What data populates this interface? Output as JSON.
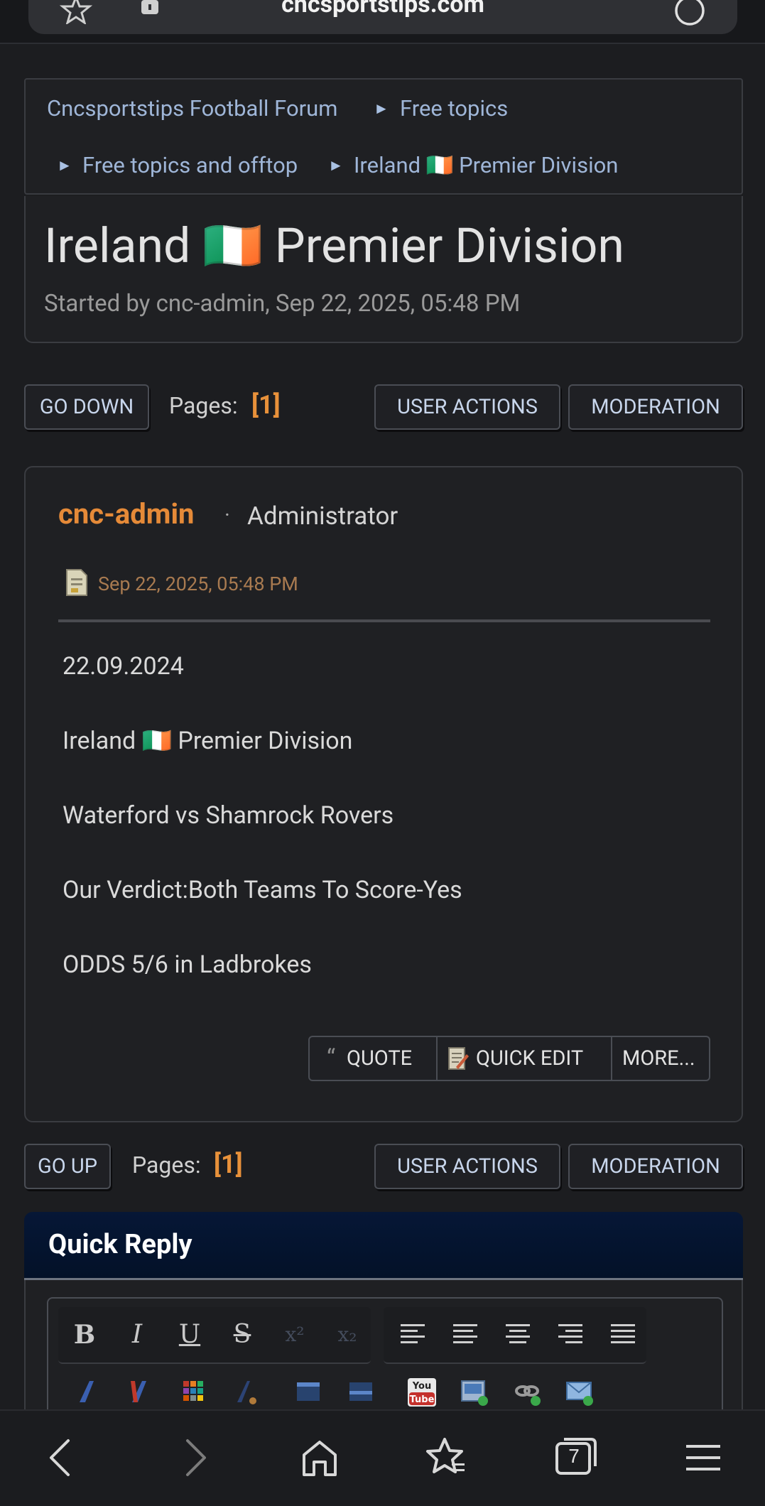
{
  "browser": {
    "url": "cncsportstips.com",
    "tab_count": "7"
  },
  "breadcrumb": {
    "items": [
      "Cncsportstips Football Forum",
      "Free topics",
      "Free topics and offtop",
      "Ireland 🇮🇪 Premier Division"
    ],
    "separator": "►"
  },
  "topic": {
    "title": "Ireland 🇮🇪 Premier Division",
    "started": "Started by cnc-admin, Sep 22, 2025, 05:48 PM"
  },
  "nav_top": {
    "go_down": "GO DOWN",
    "pages_label": "Pages:",
    "pages_value": "[1]",
    "user_actions": "USER ACTIONS",
    "moderation": "MODERATION"
  },
  "post": {
    "author": "cnc-admin",
    "role": "Administrator",
    "date": "Sep 22, 2025, 05:48 PM",
    "lines": [
      "22.09.2024",
      "Ireland 🇮🇪 Premier Division",
      "Waterford vs Shamrock Rovers",
      "Our Verdict:Both Teams To Score-Yes",
      "ODDS 5/6 in Ladbrokes"
    ],
    "actions": {
      "quote": "QUOTE",
      "quick_edit": "QUICK EDIT",
      "more": "MORE..."
    }
  },
  "nav_bottom": {
    "go_up": "GO UP",
    "pages_label": "Pages:",
    "pages_value": "[1]",
    "user_actions": "USER ACTIONS",
    "moderation": "MODERATION"
  },
  "quick_reply": {
    "title": "Quick Reply",
    "toolbar_row1": [
      "B",
      "I",
      "U",
      "S",
      "x²",
      "x₂"
    ],
    "youtube_label": "You Tube"
  },
  "colors": {
    "accent": "#e8913a",
    "link": "#9fb6d8",
    "background": "#1c1d20"
  }
}
